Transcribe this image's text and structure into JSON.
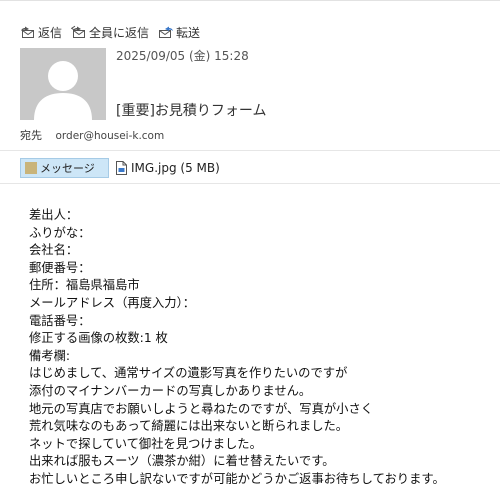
{
  "toolbar": {
    "reply_label": "返信",
    "reply_all_label": "全員に返信",
    "forward_label": "転送"
  },
  "message": {
    "date": "2025/09/05 (金) 15:28",
    "subject": "[重要]お見積りフォーム",
    "to_label": "宛先",
    "to_address": "order@housei-k.com"
  },
  "attachments": {
    "message_tab_label": "メッセージ",
    "file_label": "IMG.jpg (5 MB)"
  },
  "body": {
    "lines": [
      "差出人：",
      "ふりがな：",
      "会社名：",
      "郵便番号：",
      "住所：福島県福島市",
      "メールアドレス（再度入力）：",
      "電話番号：",
      "修正する画像の枚数:1 枚",
      "備考欄:",
      "はじめまして、通常サイズの遺影写真を作りたいのですが",
      "添付のマイナンバーカードの写真しかありません。",
      "地元の写真店でお願いしようと尋ねたのですが、写真が小さく",
      "荒れ気味なのもあって綺麗には出来ないと断られました。",
      "ネットで探していて御社を見つけました。",
      "出来れば服もスーツ（濃茶か紺）に着せ替えたいです。",
      "お忙しいところ申し訳ないですが可能かどうかご返事お待ちしております。"
    ]
  },
  "icons": {
    "reply": "reply-envelope-icon",
    "reply_all": "reply-all-envelope-icon",
    "forward": "forward-envelope-icon",
    "avatar": "default-person-avatar",
    "message_tab": "message-icon",
    "file": "document-icon"
  },
  "colors": {
    "tab_background": "#cde6f7",
    "avatar_background": "#c8c8c8",
    "forward_arrow": "#3a78c9"
  }
}
